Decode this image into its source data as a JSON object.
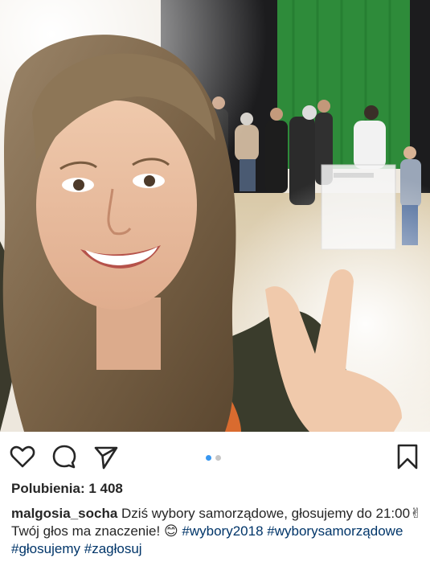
{
  "post": {
    "image_alt": "Selfie of a smiling woman showing a peace sign in a polling station",
    "carousel": {
      "current": 1,
      "total": 2
    },
    "likes_text": "Polubienia: 1 408",
    "caption": {
      "username": "malgosia_socha",
      "text_part1": "Dziś wybory samorządowe, głosujemy do 21:00",
      "emoji_victory": "✌",
      "text_part2": "Twój głos ma znaczenie!",
      "emoji_smile": "😊",
      "hashtags": [
        "#wybory2018",
        "#wyborysamorządowe",
        "#głosujemy",
        "#zagłosuj"
      ]
    }
  },
  "icons": {
    "like": "heart-icon",
    "comment": "comment-icon",
    "share": "share-icon",
    "save": "bookmark-icon"
  },
  "colors": {
    "text": "#262626",
    "hashtag": "#003569",
    "dot_active": "#3897f0",
    "dot_inactive": "#c7c7c7",
    "curtain_green": "#2e8b3a"
  }
}
